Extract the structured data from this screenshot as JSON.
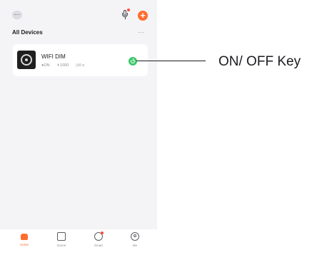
{
  "header": {
    "section_title": "All Devices",
    "more_label": "···",
    "add_label": "+"
  },
  "device": {
    "name": "WIFI DIM",
    "status_power": "ON",
    "status_brightness": "1000",
    "status_timer": "0 s"
  },
  "tabbar": {
    "tabs": [
      {
        "label": "Home",
        "active": true
      },
      {
        "label": "Scene",
        "active": false
      },
      {
        "label": "Smart",
        "active": false
      },
      {
        "label": "Me",
        "active": false
      }
    ]
  },
  "annotation": {
    "label": "ON/ OFF Key"
  },
  "colors": {
    "accent": "#ff6d2e",
    "power_green": "#3cc86a",
    "notify_red": "#ff4a3d",
    "background": "#f4f4f6"
  },
  "icons": [
    "home-tab-icon",
    "mic-icon",
    "add-icon",
    "more-icon",
    "device-thumbnail",
    "power-icon",
    "scene-icon",
    "smart-icon",
    "me-icon"
  ]
}
